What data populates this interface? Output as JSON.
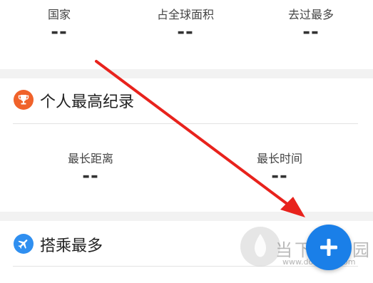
{
  "stats_top": {
    "items": [
      {
        "label": "国家",
        "value": "--"
      },
      {
        "label": "占全球面积",
        "value": "--"
      },
      {
        "label": "去过最多",
        "value": "--"
      }
    ]
  },
  "personal_record": {
    "title": "个人最高纪录",
    "icon": "trophy-icon",
    "items": [
      {
        "label": "最长距离",
        "value": "--"
      },
      {
        "label": "最长时间",
        "value": "--"
      }
    ]
  },
  "most_flown": {
    "title": "搭乘最多",
    "icon": "airplane-icon"
  },
  "fab": {
    "icon": "plus-icon"
  },
  "watermark": {
    "brand": "当下软件园",
    "url": "www.downxia.com"
  },
  "colors": {
    "trophy_accent": "#f0622a",
    "plane_accent": "#2f8ff0",
    "fab": "#1a7fe8",
    "annotation_arrow": "#e8221c",
    "band": "#f2f2f2"
  }
}
